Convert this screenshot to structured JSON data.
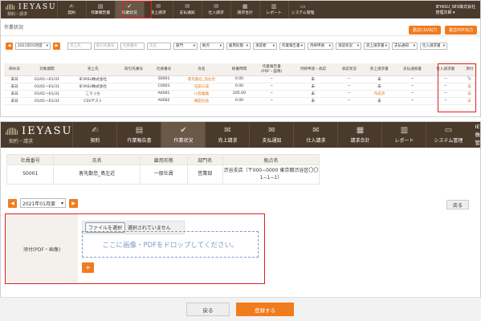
{
  "app": {
    "logo": "IEYASU",
    "logo_sub": "契約・請求"
  },
  "nav": [
    {
      "label": "契約",
      "icon": "handshake-icon",
      "glyph": "✍"
    },
    {
      "label": "作業報告書",
      "icon": "report-icon",
      "glyph": "▤"
    },
    {
      "label": "作業状況",
      "icon": "check-icon",
      "glyph": "✔"
    },
    {
      "label": "売上請求",
      "icon": "mail-icon",
      "glyph": "✉"
    },
    {
      "label": "支払通知",
      "icon": "mail-open-icon",
      "glyph": "✉"
    },
    {
      "label": "仕入請求",
      "icon": "mail-icon",
      "glyph": "✉"
    },
    {
      "label": "請求合計",
      "icon": "calculator-icon",
      "glyph": "▦"
    },
    {
      "label": "レポート",
      "icon": "chart-icon",
      "glyph": "▥"
    },
    {
      "label": "システム管理",
      "icon": "monitor-icon",
      "glyph": "▭"
    }
  ],
  "user": {
    "company": "IEYASU_SES株式会社",
    "name": "管理次郎 ▾"
  },
  "list_page": {
    "title": "作業状況",
    "btn_csv": "勤怠CSV出力",
    "btn_pdf": "勤怠PDF出力",
    "month": "2021年01月度",
    "filters": {
      "placeholders": [
        "売上先",
        "取引先番号",
        "社員番号",
        "氏名"
      ],
      "selects": [
        "部門",
        "拠点",
        "雇用形態",
        "承認者",
        "作業報告書",
        "月締申請",
        "承認状況",
        "売上請求書",
        "支払通知",
        "仕入請求書"
      ]
    },
    "columns": [
      "締め日",
      "対象期間",
      "売上先",
      "取引先番号",
      "社員番号",
      "氏名",
      "稼働時間",
      "作業報告書\n(PDF・画像)",
      "月締申請・承認",
      "承認状況",
      "売上請求書",
      "支払通知書",
      "仕入請求書",
      "添付"
    ],
    "rows": [
      [
        "末日",
        "01/01〜01/31",
        "IEYASU株式会社",
        "",
        "S0001",
        "客先勤怠_島左近",
        "0.00",
        "−",
        "未",
        "−",
        "未",
        "−",
        "−",
        "📎"
      ],
      [
        "末日",
        "01/01〜01/31",
        "IEYASU株式会社",
        "",
        "C0001",
        "石田三成",
        "0.00",
        "−",
        "未",
        "−",
        "未",
        "−",
        "−",
        "未"
      ],
      [
        "末日",
        "01/01〜01/31",
        "こりっち",
        "",
        "A0001",
        "川島雅義",
        "205.00",
        "−",
        "未",
        "−",
        "作成済",
        "−",
        "−",
        "未"
      ],
      [
        "末日",
        "01/01〜01/31",
        "CSVテスト",
        "",
        "A0002",
        "織田信長",
        "0.00",
        "−",
        "未",
        "−",
        "未",
        "−",
        "−",
        "未"
      ]
    ]
  },
  "detail_page": {
    "columns": [
      "社員番号",
      "氏名",
      "雇用形態",
      "部門名",
      "拠点名"
    ],
    "row": [
      "S0001",
      "客先勤怠_島左近",
      "一般社員",
      "営業部",
      "渋谷支店（〒000−0000 東京都渋谷区〇〇1−1−1）"
    ],
    "month": "2021年01月度",
    "back_label": "戻る",
    "attach_label": "添付(PDF・画像)",
    "file_button": "ファイルを選択",
    "file_status": "選択されていません",
    "drop_text": "ここに画像・PDFをドロップしてください。",
    "add_label": "+",
    "footer_back": "戻る",
    "footer_submit": "登録する"
  },
  "colors": {
    "accent": "#f07c1e",
    "header": "#4a3a2c",
    "highlight": "#e02020"
  }
}
